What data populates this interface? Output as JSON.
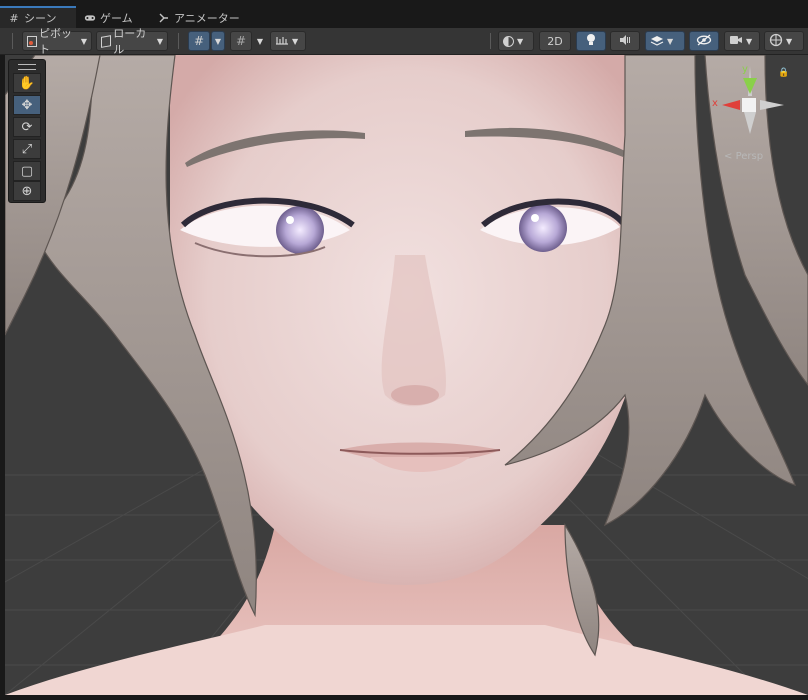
{
  "tabs": [
    {
      "label": "シーン",
      "icon": "grid-icon",
      "active": true
    },
    {
      "label": "ゲーム",
      "icon": "gamepad-icon",
      "active": false
    },
    {
      "label": "アニメーター",
      "icon": "animator-icon",
      "active": false
    }
  ],
  "toolbar": {
    "pivot_label": "ピボット",
    "local_label": "ローカル",
    "mode_2d_label": "2D"
  },
  "viewport": {
    "projection_label": "Persp",
    "axis_x_label": "x",
    "axis_y_label": "y"
  },
  "colors": {
    "accent": "#46607c",
    "tab_highlight": "#3a79bb",
    "axis_x": "#e0403a",
    "axis_y": "#8ad04a",
    "background": "#191919",
    "toolbar": "#353535",
    "ground_grid": "#3a3a3a",
    "skin": "#ecd6d4",
    "hair": "#a89e99"
  },
  "tools": [
    "hand-tool-icon",
    "move-tool-icon",
    "rotate-tool-icon",
    "scale-tool-icon",
    "rect-tool-icon",
    "transform-tool-icon"
  ]
}
